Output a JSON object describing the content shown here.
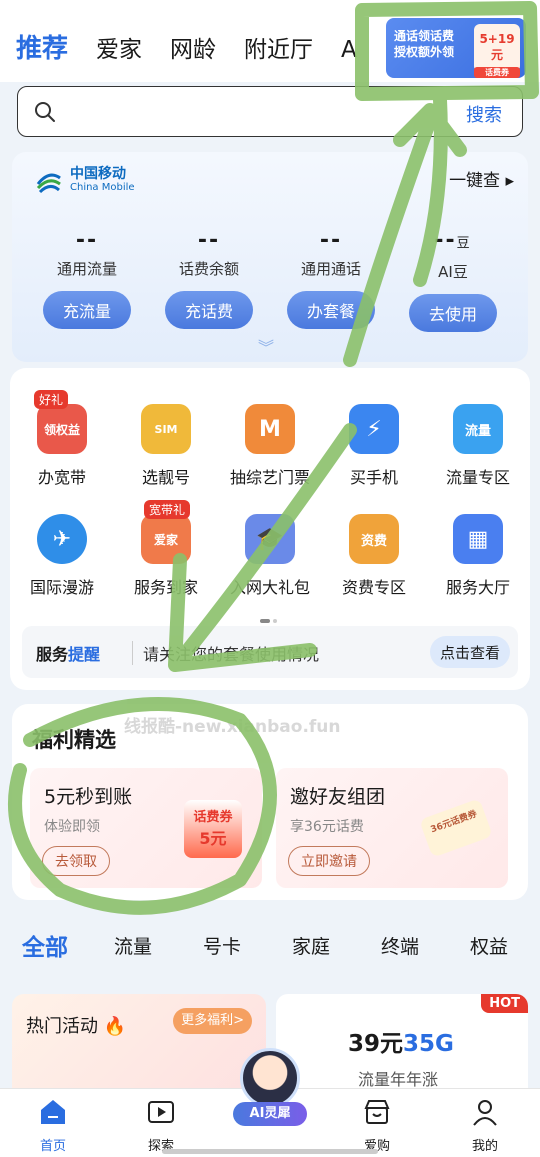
{
  "topnav": {
    "tabs": [
      {
        "label": "推荐",
        "active": true
      },
      {
        "label": "爱家",
        "active": false
      },
      {
        "label": "网龄",
        "active": false
      },
      {
        "label": "附近厅",
        "active": false
      },
      {
        "label": "A",
        "active": false
      }
    ],
    "promo": {
      "line1": "通话领话费",
      "line2": "授权额外领",
      "badge_value": "5+19元",
      "badge_tag": "话费券"
    }
  },
  "search": {
    "placeholder": "",
    "button_label": "搜索",
    "icon": "search-icon"
  },
  "account": {
    "brand_cn": "中国移动",
    "brand_en": "China Mobile",
    "one_key_check": "一键查",
    "stats": [
      {
        "value": "--",
        "label": "通用流量",
        "button": "充流量"
      },
      {
        "value": "--",
        "label": "话费余额",
        "button": "充话费"
      },
      {
        "value": "--",
        "label": "通用通话",
        "button": "办套餐"
      },
      {
        "value": "--",
        "unit": "豆",
        "label": "AI豆",
        "button": "去使用"
      }
    ]
  },
  "services": {
    "items": [
      {
        "label": "办宽带",
        "tag": "好礼",
        "sub": "领权益",
        "icon": "gift-box-icon",
        "color": "#e9584a"
      },
      {
        "label": "选靓号",
        "icon": "sim-card-icon",
        "sub": "SIM",
        "color": "#f0b93a"
      },
      {
        "label": "抽综艺门票",
        "icon": "ticket-icon",
        "color": "#f08a3a"
      },
      {
        "label": "买手机",
        "icon": "phone-icon",
        "color": "#3b86f0"
      },
      {
        "label": "流量专区",
        "icon": "store-icon",
        "sub": "流量",
        "color": "#3aa2f0"
      },
      {
        "label": "国际漫游",
        "icon": "airplane-globe-icon",
        "color": "#2f8ee8"
      },
      {
        "label": "服务到家",
        "tag": "宽带礼",
        "sub": "爱家",
        "icon": "house-icon",
        "color": "#f07a4a"
      },
      {
        "label": "入网大礼包",
        "icon": "graduation-cap-icon",
        "color": "#6a8ae8"
      },
      {
        "label": "资费专区",
        "icon": "tariff-folder-icon",
        "sub": "资费",
        "color": "#f0a33a"
      },
      {
        "label": "服务大厅",
        "icon": "grid-apps-icon",
        "color": "#4a7ff0"
      }
    ],
    "reminder": {
      "title_plain": "服务",
      "title_highlight": "提醒",
      "message": "请关注您的套餐使用情况",
      "button": "点击查看"
    }
  },
  "welfare": {
    "watermark": "线报酷-new.xianbao.fun",
    "title": "福利精选",
    "cards": [
      {
        "title": "5元秒到账",
        "subtitle": "体验即领",
        "button": "去领取",
        "art_label": "话费券",
        "art_value": "5元"
      },
      {
        "title": "邀好友组团",
        "subtitle": "享36元话费",
        "button": "立即邀请",
        "art_label": "36元话费券"
      }
    ]
  },
  "categories": [
    "全部",
    "流量",
    "号卡",
    "家庭",
    "终端",
    "权益"
  ],
  "hot_activity": {
    "title": "热门活动",
    "more": "更多福利>"
  },
  "plan_card": {
    "hot": "HOT",
    "price_plain": "39元",
    "price_highlight": "35G",
    "desc": "流量年年涨"
  },
  "bottom_nav": [
    {
      "label": "首页",
      "icon": "home-icon",
      "active": true
    },
    {
      "label": "探索",
      "icon": "play-icon",
      "active": false
    },
    {
      "label": "AI灵犀",
      "icon": "ai-avatar-icon",
      "active": false
    },
    {
      "label": "爱购",
      "icon": "shop-icon",
      "active": false
    },
    {
      "label": "我的",
      "icon": "user-icon",
      "active": false
    }
  ],
  "colors": {
    "accent": "#2a6de0",
    "annotation": "#8bc06a"
  }
}
